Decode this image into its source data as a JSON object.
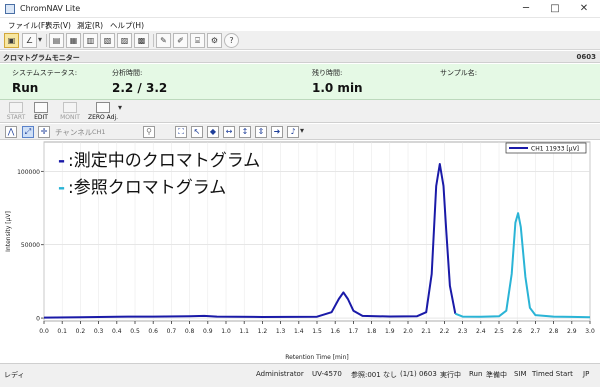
{
  "window": {
    "title": "ChromNAV Lite"
  },
  "menu": [
    {
      "label": "ファイル(F)"
    },
    {
      "label": "表示(V)"
    },
    {
      "label": "測定(R)"
    },
    {
      "label": "ヘルプ(H)"
    }
  ],
  "panel": {
    "title": "クロマトグラムモニター",
    "code": "0603"
  },
  "status": {
    "system_status_label": "システムステータス:",
    "system_status_value": "Run",
    "analysis_time_label": "分析時間:",
    "analysis_time_value": "2.2 / 3.2",
    "remaining_time_label": "残り時間:",
    "remaining_time_value": "1.0 min",
    "sample_name_label": "サンプル名:",
    "sample_name_value": ""
  },
  "run_toolbar": [
    {
      "label": "START",
      "disabled": true
    },
    {
      "label": "EDIT",
      "disabled": false
    },
    {
      "label": "MONIT",
      "disabled": true
    },
    {
      "label": "ZERO Adj.",
      "disabled": false
    }
  ],
  "channel_bar": {
    "label": "チャンネル",
    "value": "CH1"
  },
  "chart_data": {
    "type": "line",
    "xlabel": "Retention Time [min]",
    "ylabel": "Intensity [μV]",
    "xlim": [
      0.0,
      3.0
    ],
    "ylim": [
      -2000,
      120000
    ],
    "xticks": [
      "0.0",
      "0.1",
      "0.2",
      "0.3",
      "0.4",
      "0.5",
      "0.6",
      "0.7",
      "0.8",
      "0.9",
      "1.0",
      "1.1",
      "1.2",
      "1.3",
      "1.4",
      "1.5",
      "1.6",
      "1.7",
      "1.8",
      "1.9",
      "2.0",
      "2.1",
      "2.2",
      "2.3",
      "2.4",
      "2.5",
      "2.6",
      "2.7",
      "2.8",
      "2.9",
      "3.0"
    ],
    "yticks": [
      0,
      50000,
      100000
    ],
    "legend": {
      "entry": "CH1 11933 [μV]",
      "placement": "top-right",
      "color": "#1a1aa8"
    },
    "annotations": [
      {
        "marker": "-",
        "text": ":測定中のクロマトグラム",
        "color": "#1a1aa8"
      },
      {
        "marker": "-",
        "text": ":参照クロマトグラム",
        "color": "#2ab4d6"
      }
    ],
    "series": [
      {
        "name": "測定中のクロマトグラム",
        "color": "#1a1aa8",
        "x": [
          0.0,
          0.2,
          0.4,
          0.6,
          0.8,
          0.88,
          0.95,
          1.2,
          1.5,
          1.58,
          1.62,
          1.645,
          1.67,
          1.7,
          1.75,
          1.9,
          2.05,
          2.1,
          2.13,
          2.155,
          2.175,
          2.195,
          2.21,
          2.23,
          2.26
        ],
        "y": [
          300,
          500,
          900,
          1000,
          1200,
          1500,
          1000,
          700,
          900,
          4000,
          13000,
          17500,
          13000,
          5000,
          1500,
          1100,
          1300,
          4000,
          30000,
          90000,
          105000,
          90000,
          60000,
          22000,
          3000
        ]
      },
      {
        "name": "参照クロマトグラム",
        "color": "#2ab4d6",
        "x": [
          2.26,
          2.3,
          2.4,
          2.5,
          2.54,
          2.57,
          2.59,
          2.605,
          2.62,
          2.645,
          2.67,
          2.7,
          2.8,
          2.9,
          3.0
        ],
        "y": [
          3000,
          1000,
          900,
          1200,
          5000,
          30000,
          65000,
          71500,
          62000,
          28000,
          7000,
          2000,
          1000,
          800,
          600
        ]
      }
    ]
  },
  "statusbar": {
    "left": "レディ",
    "items": [
      "Administrator",
      "UV-4570",
      "参照:001",
      "なし",
      "(1/1) 0603",
      "実行中",
      "Run",
      "準備中",
      "SIM",
      "Timed Start",
      "JP"
    ]
  }
}
